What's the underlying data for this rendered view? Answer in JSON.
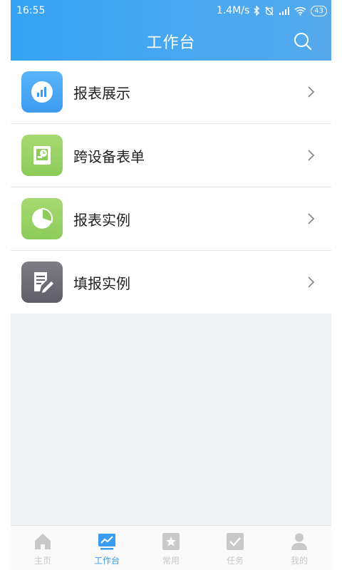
{
  "status_bar": {
    "time": "16:55",
    "speed": "1.4M/s",
    "battery": "43"
  },
  "header": {
    "title": "工作台"
  },
  "menu": {
    "items": [
      {
        "label": "报表展示",
        "icon": "bar-chart-icon",
        "color": "#3c9bf0"
      },
      {
        "label": "跨设备表单",
        "icon": "device-clock-icon",
        "color": "#8ccc5a"
      },
      {
        "label": "报表实例",
        "icon": "pie-chart-icon",
        "color": "#8ccc5a"
      },
      {
        "label": "填报实例",
        "icon": "edit-document-icon",
        "color": "#65646e"
      }
    ]
  },
  "tabbar": {
    "active_color": "#3a9cf0",
    "inactive_color": "#c8c8c8",
    "tabs": [
      {
        "label": "主页",
        "icon": "home-icon"
      },
      {
        "label": "工作台",
        "icon": "workbench-icon"
      },
      {
        "label": "常用",
        "icon": "star-icon"
      },
      {
        "label": "任务",
        "icon": "task-check-icon"
      },
      {
        "label": "我的",
        "icon": "user-icon"
      }
    ],
    "active_index": 1
  }
}
